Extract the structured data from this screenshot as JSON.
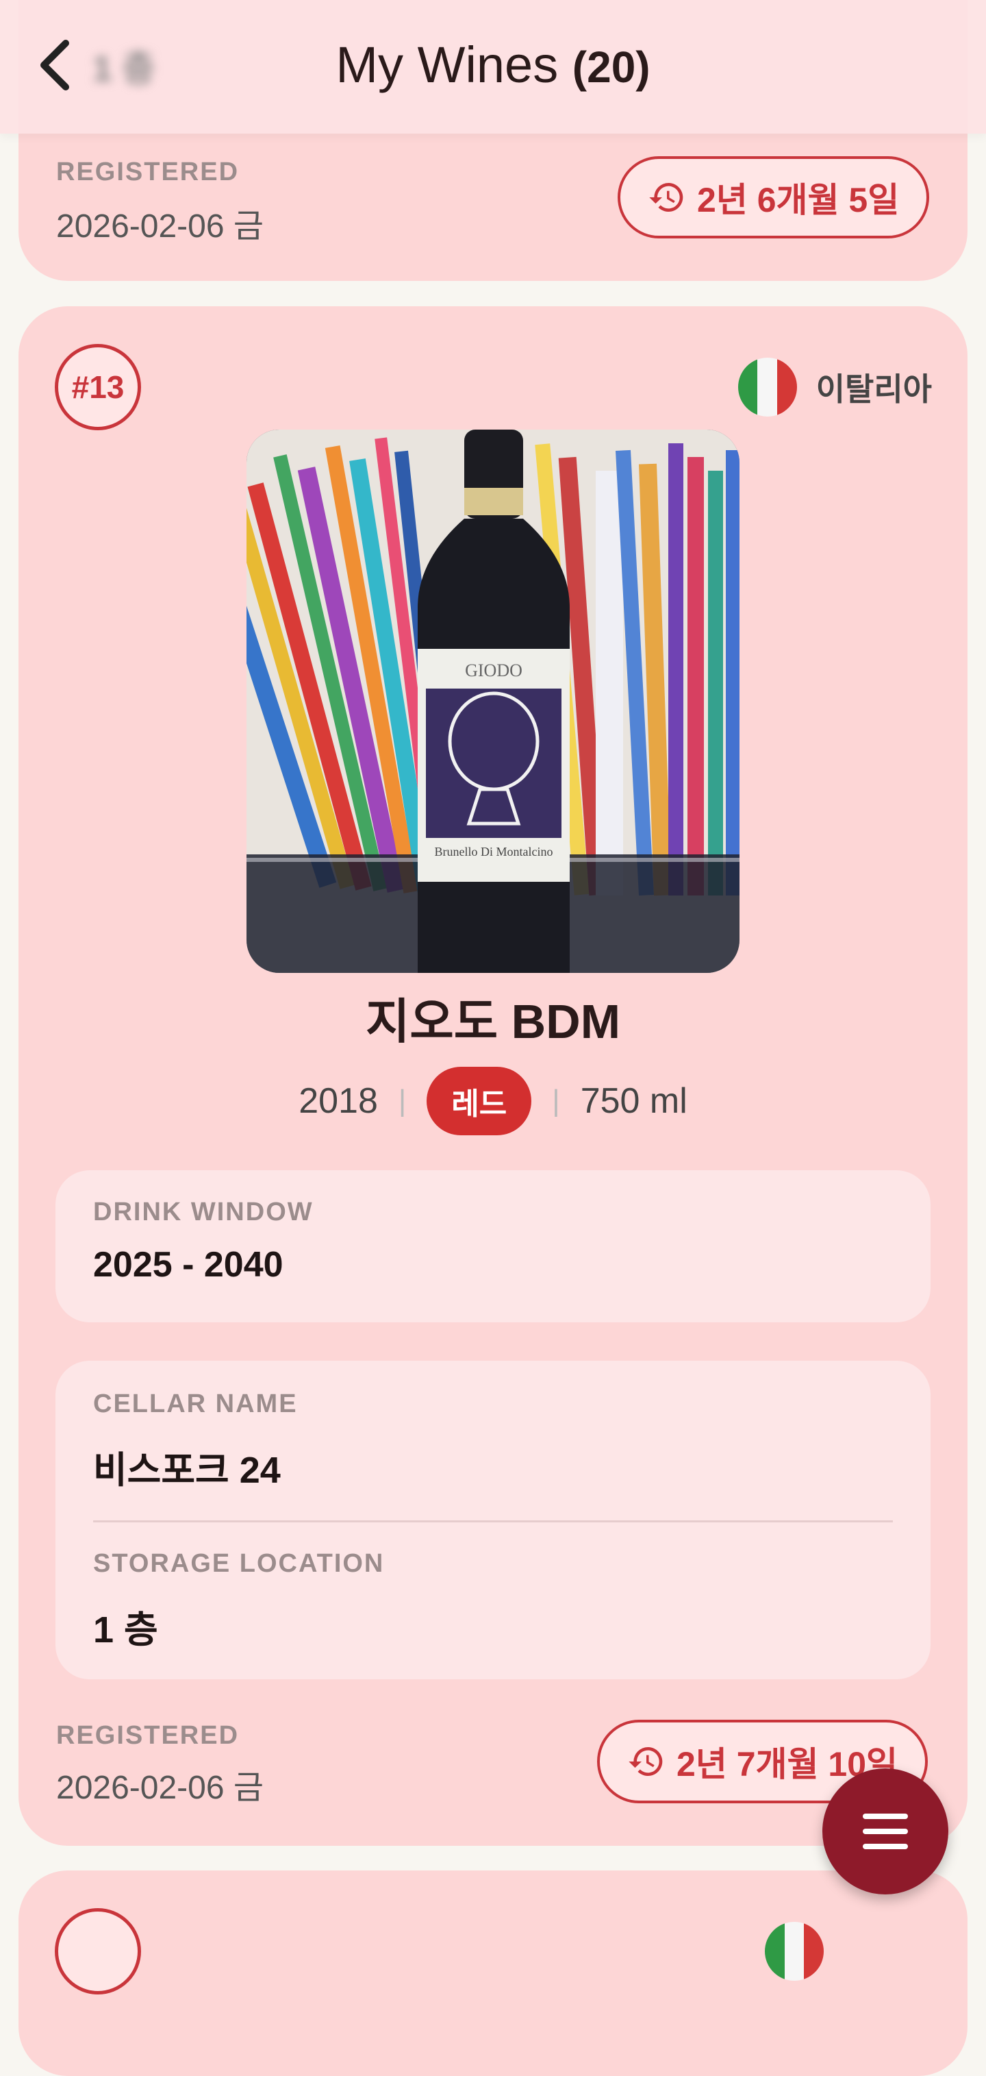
{
  "header": {
    "title": "My Wines",
    "count": "(20)",
    "blurred_peek": "1 층"
  },
  "prev_card": {
    "registered_label": "REGISTERED",
    "registered_date": "2026-02-06 금",
    "age_badge": "2년 6개월 5일"
  },
  "wine_card": {
    "number": "#13",
    "country": "이탈리아",
    "photo_alt": "GIODO Brunello Di Montalcino bottle",
    "bottle_label_brand": "GIODO",
    "bottle_label_name": "Brunello Di Montalcino",
    "name": "지오도 BDM",
    "vintage": "2018",
    "type": "레드",
    "volume": "750 ml",
    "sep": "|",
    "drink_window_label": "DRINK WINDOW",
    "drink_window_value": "2025 - 2040",
    "cellar_name_label": "CELLAR NAME",
    "cellar_name_value": "비스포크 24",
    "storage_label": "STORAGE LOCATION",
    "storage_value": "1 층",
    "registered_label": "REGISTERED",
    "registered_date": "2026-02-06 금",
    "age_badge": "2년 7개월 10일"
  },
  "colors": {
    "accent": "#c9353b",
    "card_bg": "#fdd6d6",
    "fab": "#8e1a2a"
  }
}
